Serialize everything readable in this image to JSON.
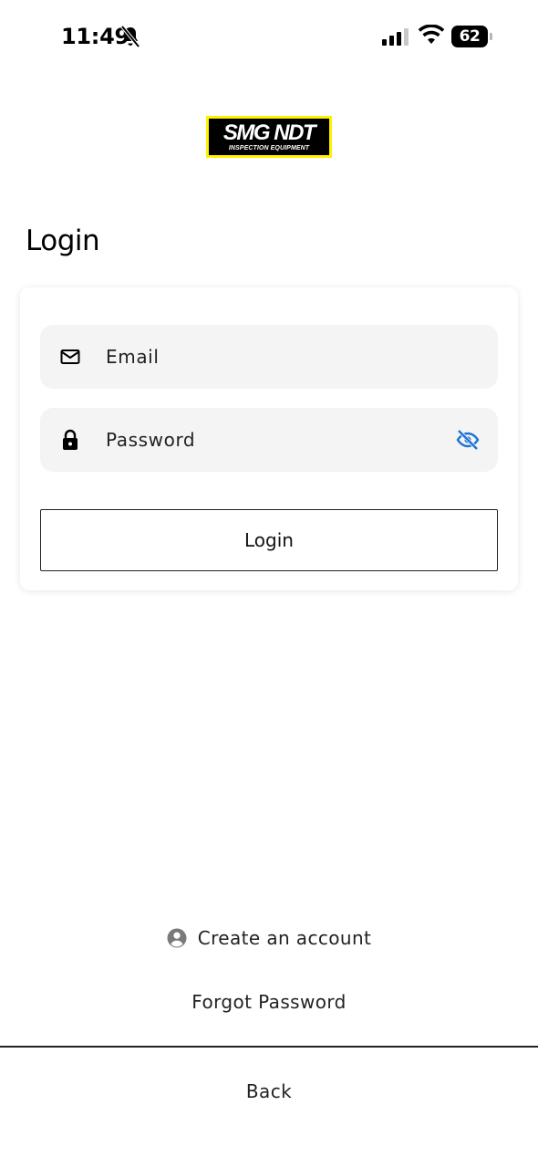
{
  "status_bar": {
    "time": "11:49",
    "battery_level": "62",
    "icons": [
      "bell-off-icon",
      "signal-icon",
      "wifi-icon",
      "battery-icon"
    ]
  },
  "logo": {
    "main_text": "SMG NDT",
    "sub_text": "INSPECTION EQUIPMENT",
    "colors": {
      "background": "#000000",
      "border": "#fff200",
      "text": "#ffffff"
    }
  },
  "page": {
    "title": "Login"
  },
  "form": {
    "email": {
      "placeholder": "Email",
      "icon": "mail-icon"
    },
    "password": {
      "placeholder": "Password",
      "icon": "lock-icon",
      "toggle_icon": "eye-off-icon"
    },
    "submit_label": "Login"
  },
  "links": {
    "create_account": "Create an account",
    "create_account_icon": "account-circle-icon",
    "forgot_password": "Forgot Password",
    "back": "Back"
  },
  "colors": {
    "accent": "#1e73d2",
    "field_background": "#f4f4f4"
  }
}
